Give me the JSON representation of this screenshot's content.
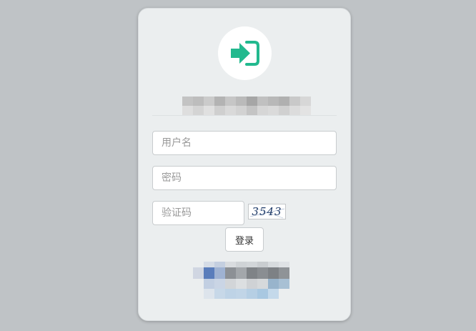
{
  "login": {
    "username_placeholder": "用户名",
    "password_placeholder": "密码",
    "captcha_placeholder": "验证码",
    "captcha_text": "3543",
    "submit_label": "登录"
  },
  "icons": {
    "logo": "sign-in-icon"
  },
  "colors": {
    "background": "#bfc3c6",
    "card": "#ebeeef",
    "accent": "#22b98e"
  }
}
